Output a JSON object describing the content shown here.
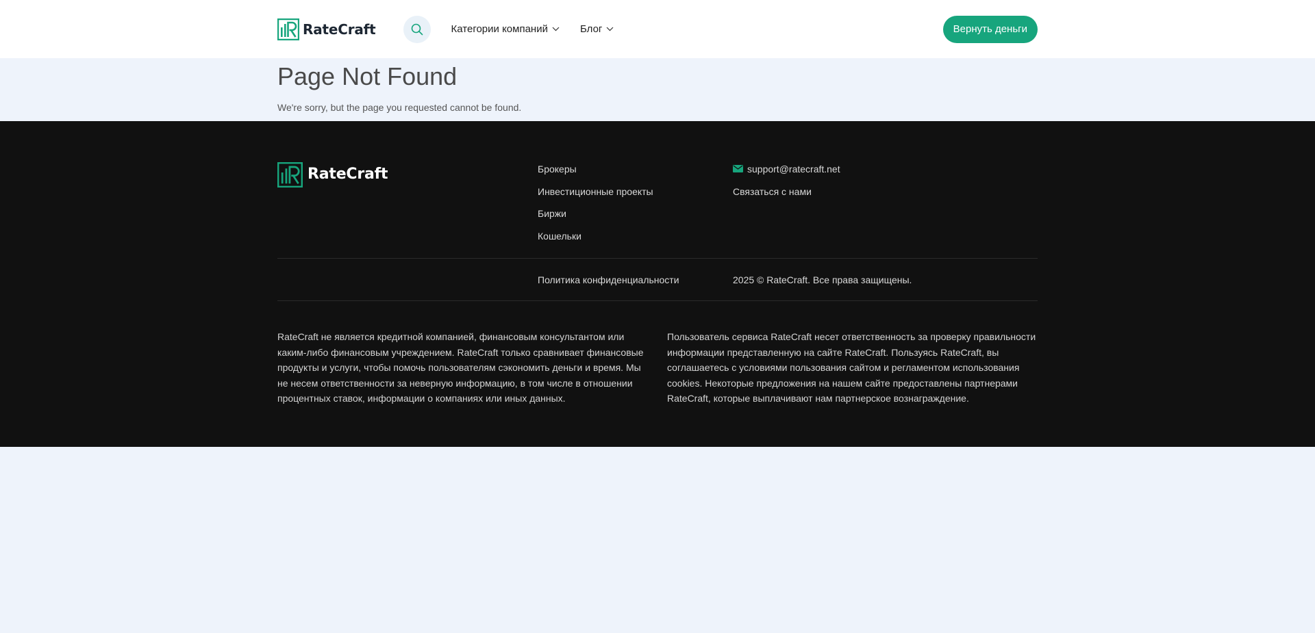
{
  "brand": {
    "name": "RateCraft",
    "accent": "#17a57d"
  },
  "header": {
    "nav": [
      {
        "label": "Категории компаний",
        "icon": "chevron-down-icon"
      },
      {
        "label": "Блог",
        "icon": "chevron-down-icon"
      }
    ],
    "search_icon": "search-icon",
    "cta_label": "Вернуть деньги"
  },
  "notfound": {
    "title": "Page Not Found",
    "message": "We're sorry, but the page you requested cannot be found."
  },
  "footer": {
    "links": [
      "Брокеры",
      "Инвестиционные проекты",
      "Биржи",
      "Кошельки"
    ],
    "email": "support@ratecraft.net",
    "contact_label": "Связаться с нами",
    "privacy_label": "Политика конфиденциальности",
    "copyright": "2025 © RateCraft. Все права защищены.",
    "disclaimer_left": "RateCraft не является кредитной компанией, финансовым консультантом или каким-либо финансовым учреждением. RateCraft только сравнивает финансовые продукты и услуги, чтобы помочь пользователям сэкономить деньги и время. Мы не несем ответственности за неверную информацию, в том числе в отношении процентных ставок, информации о компаниях или иных данных.",
    "disclaimer_right": "Пользователь сервиса RateCraft несет ответственность за проверку правильности информации представленную на сайте RateCraft. Пользуясь RateCraft, вы соглашаетесь с условиями пользования сайтом и регламентом использования cookies. Некоторые предложения на нашем сайте предоставлены партнерами RateCraft, которые выплачивают нам партнерское вознаграждение."
  }
}
